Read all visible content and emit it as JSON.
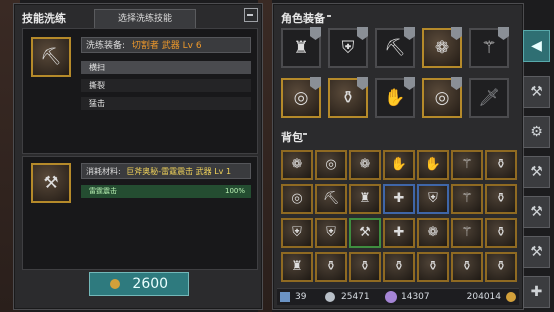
{
  "left_panel": {
    "title": "技能洗练",
    "tab_label": "选择洗练技能",
    "equip_label": "洗练装备:",
    "equip_value": "切割者 武器 Lv 6",
    "skills": [
      "横扫",
      "撕裂",
      "猛击"
    ],
    "consume_label": "消耗材料:",
    "consume_value": "巨斧奥秘-雷霆震击 武器 Lv 1",
    "consume_skill": "雷霆震击",
    "consume_percent": "100%",
    "cost_value": "2600",
    "equip_icon": "chest-axe-icon",
    "material_icon": "axe-rune-icon"
  },
  "right_panel": {
    "equip_title": "角色装备",
    "bag_title": "背包",
    "equip_slots": [
      {
        "icon": "helmet-icon",
        "border": "dark-badge"
      },
      {
        "icon": "armor-icon",
        "border": "dark-badge"
      },
      {
        "icon": "axe-icon",
        "border": "dark-badge"
      },
      {
        "icon": "amulet-icon",
        "border": "dark-badge"
      },
      {
        "icon": "staff-icon",
        "border": "dark-badge"
      },
      {
        "icon": "ring-icon",
        "border": "dark-badge"
      },
      {
        "icon": "bag-icon",
        "border": "dark-badge"
      },
      {
        "icon": "gloves-icon",
        "border": "dark-badge"
      },
      {
        "icon": "ring-icon",
        "border": "dark-badge"
      },
      {
        "icon": "sword-icon",
        "border": "empty"
      }
    ],
    "currencies": [
      {
        "icon": "strength-icon",
        "value": "39"
      },
      {
        "icon": "energy-icon",
        "value": "25471"
      },
      {
        "icon": "gem-icon",
        "value": "14307"
      },
      {
        "icon": "gold-icon",
        "value": "204014"
      }
    ]
  },
  "side_tabs": [
    {
      "icon": "arrow-tab-icon",
      "active": true
    },
    {
      "icon": "hammer-icon",
      "active": false
    },
    {
      "icon": "anvil-icon",
      "active": false
    },
    {
      "icon": "hammer-icon",
      "active": false
    },
    {
      "icon": "hammer-icon",
      "active": false
    },
    {
      "icon": "hammer-icon",
      "active": false
    },
    {
      "icon": "hammer-plus-icon",
      "active": false
    }
  ]
}
